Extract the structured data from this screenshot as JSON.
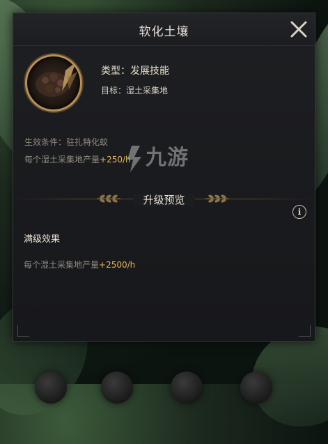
{
  "dialog": {
    "title": "软化土壤",
    "type_label": "类型：发展技能",
    "target_label": "目标：湿土采集地",
    "condition": "生效条件：驻扎特化蚁",
    "yield_prefix": "每个湿土采集地产量",
    "yield_value": "+250/h",
    "section_title": "升级预览",
    "max_effect_title": "满级效果",
    "max_yield_prefix": "每个湿土采集地产量",
    "max_yield_value": "+2500/h"
  },
  "watermark": {
    "text": "九游"
  },
  "icons": {
    "close": "close-icon",
    "info": "info-icon",
    "skill": "soil-skill-icon",
    "wheat": "wheat-ornament-icon"
  },
  "colors": {
    "accent": "#e6b35a",
    "panel_bg": "#1c1d20",
    "text_primary": "#e8e2cf",
    "text_secondary": "#8f8b80"
  }
}
